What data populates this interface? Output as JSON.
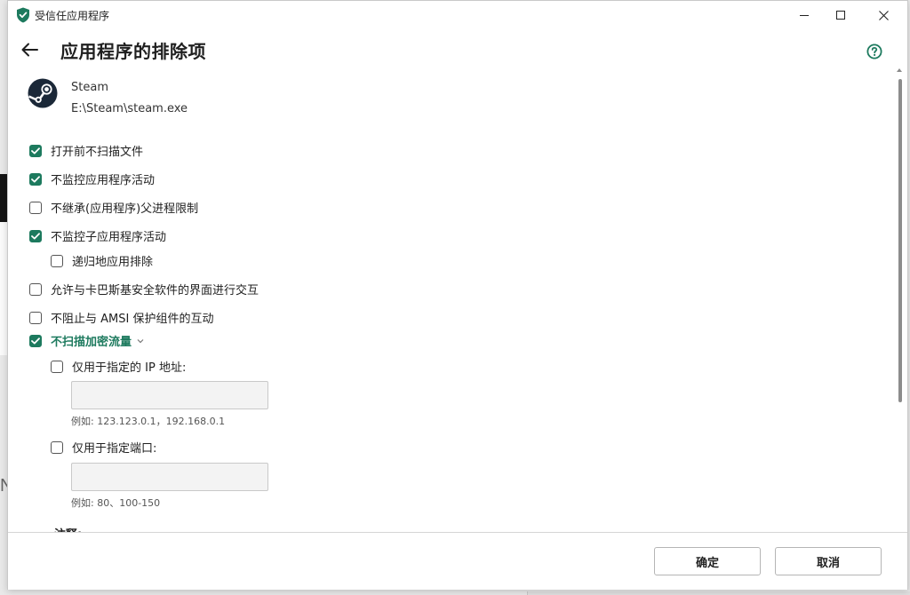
{
  "window": {
    "title": "受信任应用程序"
  },
  "header": {
    "title": "应用程序的排除项"
  },
  "app": {
    "name": "Steam",
    "path": "E:\\Steam\\steam.exe"
  },
  "options": [
    {
      "label": "打开前不扫描文件",
      "checked": true
    },
    {
      "label": "不监控应用程序活动",
      "checked": true
    },
    {
      "label": "不继承(应用程序)父进程限制",
      "checked": false
    },
    {
      "label": "不监控子应用程序活动",
      "checked": true
    },
    {
      "label": "递归地应用排除",
      "checked": false
    },
    {
      "label": "允许与卡巴斯基安全软件的界面进行交互",
      "checked": false
    },
    {
      "label": "不阻止与 AMSI 保护组件的互动",
      "checked": false
    },
    {
      "label": "不扫描加密流量",
      "checked": true
    }
  ],
  "ip_filter": {
    "label": "仅用于指定的 IP 地址:",
    "checked": false,
    "value": "",
    "hint": "例如: 123.123.0.1，192.168.0.1"
  },
  "port_filter": {
    "label": "仅用于指定端口:",
    "checked": false,
    "value": "",
    "hint": "例如: 80、100-150"
  },
  "notes_label": "注释:",
  "footer": {
    "ok_label": "确定",
    "cancel_label": "取消"
  },
  "colors": {
    "accent": "#1d7a5e",
    "steam": "#1b2838"
  },
  "icons": {
    "back": "arrow-left-icon",
    "help": "help-circle-icon",
    "app": "steam-logo-icon",
    "title": "shield-icon"
  }
}
